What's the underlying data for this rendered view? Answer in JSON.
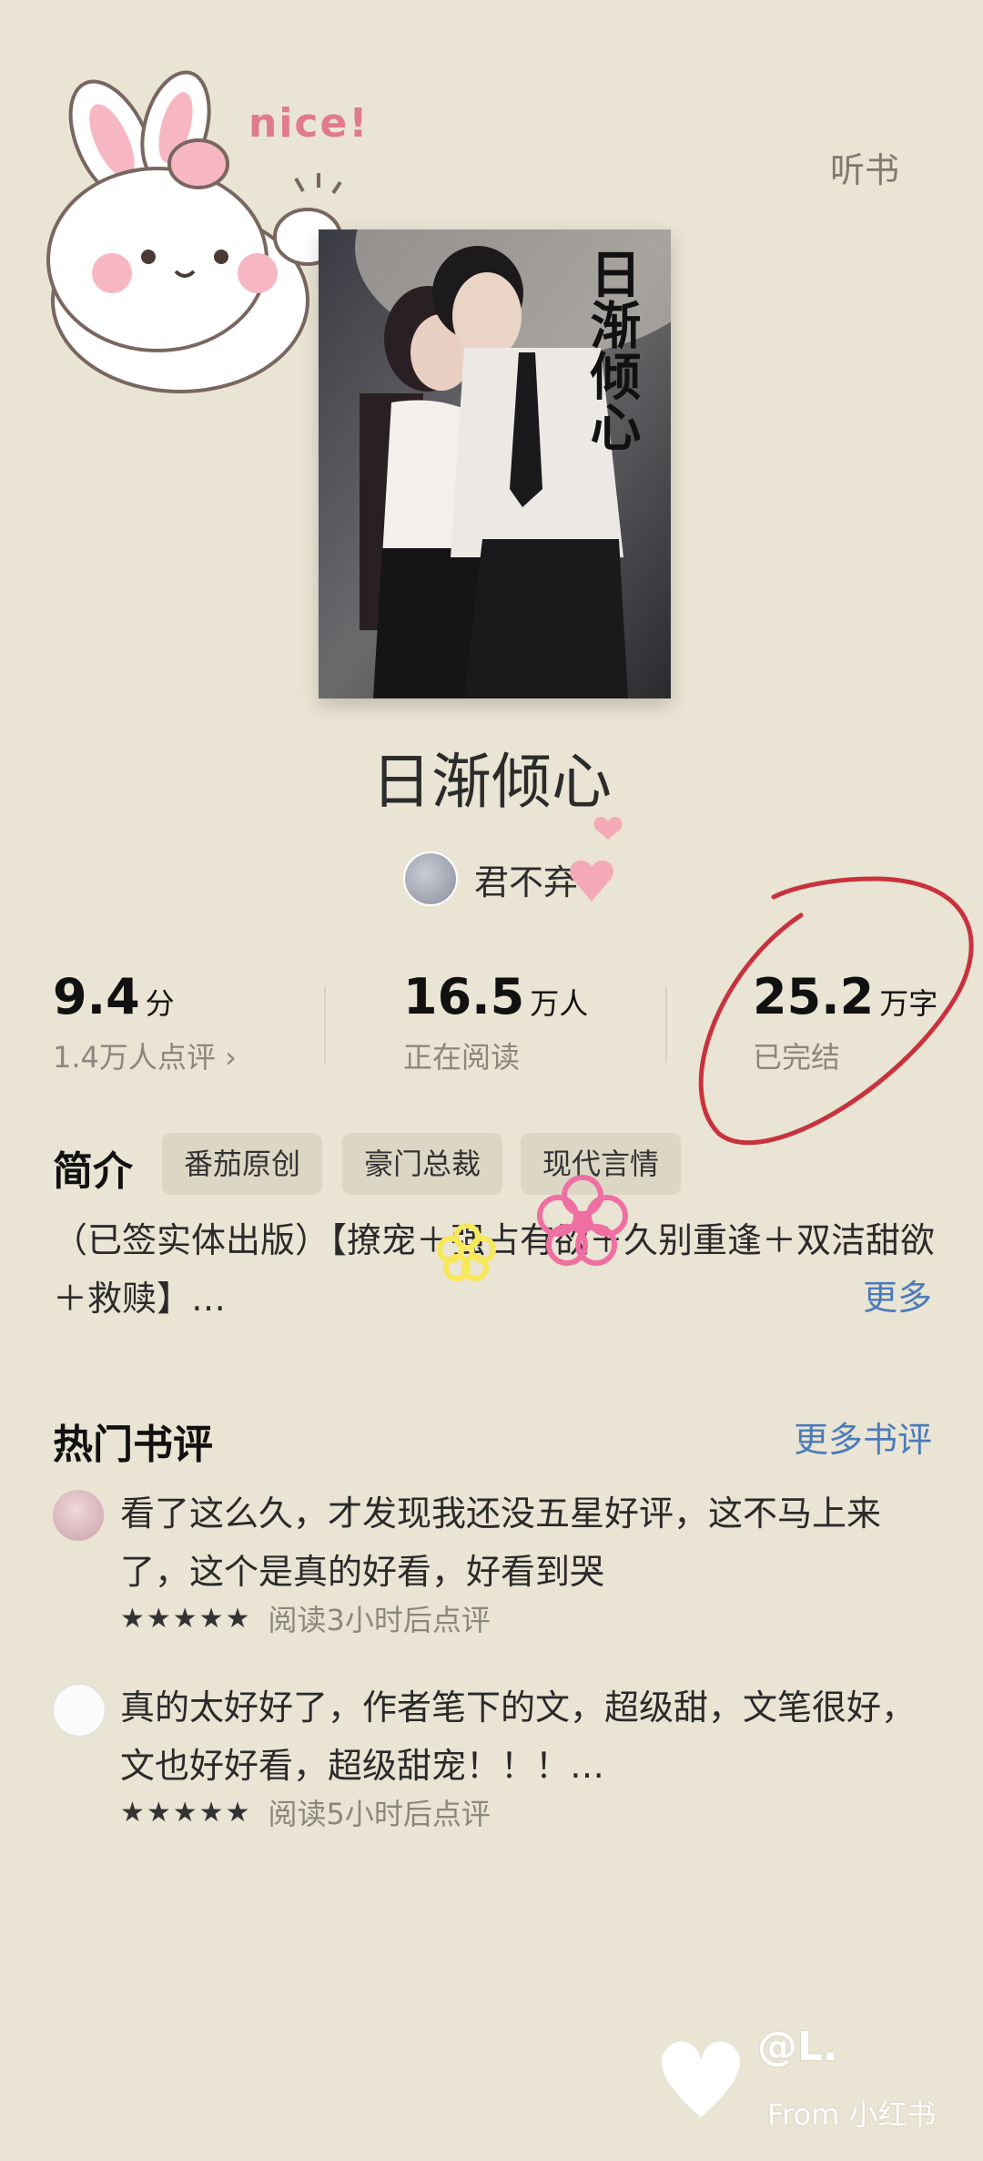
{
  "header": {
    "listen_label": "听书"
  },
  "sticker": {
    "text": "nice!"
  },
  "cover": {
    "title_vertical": "日渐倾心"
  },
  "book": {
    "title": "日渐倾心",
    "author": "君不弃"
  },
  "stats": [
    {
      "value": "9.4",
      "unit": "分",
      "caption": "1.4万人点评 ›"
    },
    {
      "value": "16.5",
      "unit": "万人",
      "caption": "正在阅读"
    },
    {
      "value": "25.2",
      "unit": "万字",
      "caption": "已完结"
    }
  ],
  "summary": {
    "section_title": "简介",
    "tags": [
      "番茄原创",
      "豪门总裁",
      "现代言情"
    ],
    "text": "（已签实体出版）【撩宠＋强占有欲＋久别重逢＋双洁甜欲＋救赎】…",
    "more_label": "更多"
  },
  "reviews": {
    "section_title": "热门书评",
    "more_label": "更多书评",
    "items": [
      {
        "text": "看了这么久，才发现我还没五星好评，这不马上来了，这个是真的好看，好看到哭",
        "stars": "★★★★★",
        "meta": "阅读3小时后点评"
      },
      {
        "text": "真的太好好了，作者笔下的文，超级甜，文笔很好，文也好好看，超级甜宠！！！…",
        "stars": "★★★★★",
        "meta": "阅读5小时后点评"
      }
    ]
  },
  "watermark": {
    "handle": "@L.",
    "source": "From 小红书"
  },
  "colors": {
    "background": "#e9e4d3",
    "link": "#4b7bb9",
    "annotation_red": "#c8323c",
    "sticker_pink": "#f3a6b3",
    "sticker_yellow": "#f7e85a"
  }
}
